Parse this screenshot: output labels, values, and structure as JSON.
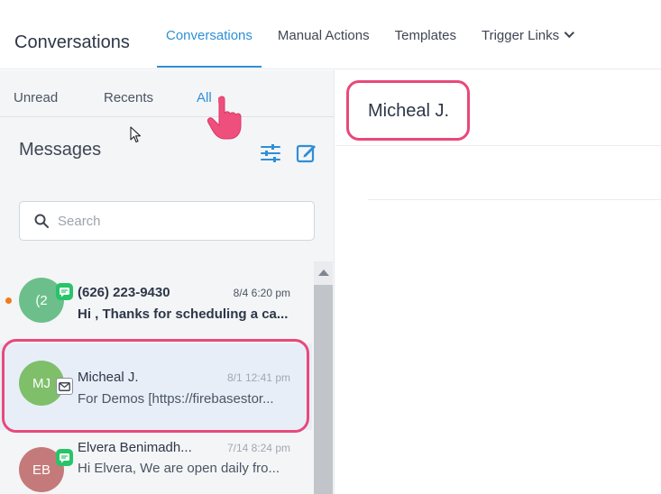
{
  "header": {
    "app_title": "Conversations",
    "tabs": [
      {
        "label": "Conversations",
        "active": true
      },
      {
        "label": "Manual Actions"
      },
      {
        "label": "Templates"
      },
      {
        "label": "Trigger Links",
        "has_dropdown": true
      }
    ]
  },
  "sidebar": {
    "filters": [
      "Unread",
      "Recents",
      "All"
    ],
    "active_filter": "All",
    "title": "Messages",
    "search_placeholder": "Search",
    "conversations": [
      {
        "initials": "(2",
        "name": "(626) 223-9430",
        "time": "8/4 6:20 pm",
        "preview": "Hi , Thanks for scheduling a ca...",
        "channel": "sms",
        "unread": true,
        "avatar_color": "#6cbf8a"
      },
      {
        "initials": "MJ",
        "name": "Micheal J.",
        "time": "8/1 12:41 pm",
        "preview": "For Demos [https://firebasestor...",
        "channel": "email",
        "unread": false,
        "avatar_color": "#7fbf6a"
      },
      {
        "initials": "EB",
        "name": "Elvera Benimadh...",
        "time": "7/14 8:24 pm",
        "preview": "Hi Elvera, We are open daily fro...",
        "channel": "sms",
        "unread": false,
        "avatar_color": "#c47a7a"
      }
    ]
  },
  "main": {
    "contact_name": "Micheal J."
  },
  "colors": {
    "accent": "#2f8fd6",
    "highlight": "#e8497a",
    "sms_badge": "#27c469",
    "unread_dot": "#f07b1d"
  }
}
